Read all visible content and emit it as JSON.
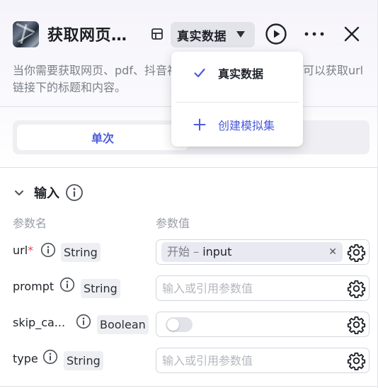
{
  "header": {
    "title": "获取网页…",
    "mode_label": "真实数据",
    "icons": [
      "app-logo-icon",
      "dataset-icon",
      "chevron-down-icon",
      "run-icon",
      "more-icon",
      "close-icon"
    ]
  },
  "description": "当你需要获取网页、pdf、抖音视频内容时，使用此工具。可以获取url链接下的标题和内容。",
  "tabs": [
    {
      "label": "单次",
      "active": true
    },
    {
      "label": "",
      "active": false
    }
  ],
  "dropdown": {
    "items": [
      {
        "label": "真实数据",
        "selected": true,
        "icon": "check-icon"
      },
      {
        "label": "创建模拟集",
        "selected": false,
        "icon": "plus-icon"
      }
    ]
  },
  "inputs": {
    "title": "输入",
    "col_name": "参数名",
    "col_value": "参数值",
    "params": [
      {
        "name": "url",
        "required": true,
        "type": "String",
        "ref_source": "开始",
        "ref_sep": " – ",
        "ref_field": "input",
        "placeholder": ""
      },
      {
        "name": "prompt",
        "required": false,
        "type": "String",
        "placeholder": "输入或引用参数值"
      },
      {
        "name": "skip_ca...",
        "required": false,
        "type": "Boolean",
        "toggle": false
      },
      {
        "name": "type",
        "required": false,
        "type": "String",
        "placeholder": "输入或引用参数值"
      }
    ]
  },
  "colors": {
    "accent": "#4b5bdb",
    "required": "#e5484d",
    "mode_bg": "#e3e4ea"
  }
}
